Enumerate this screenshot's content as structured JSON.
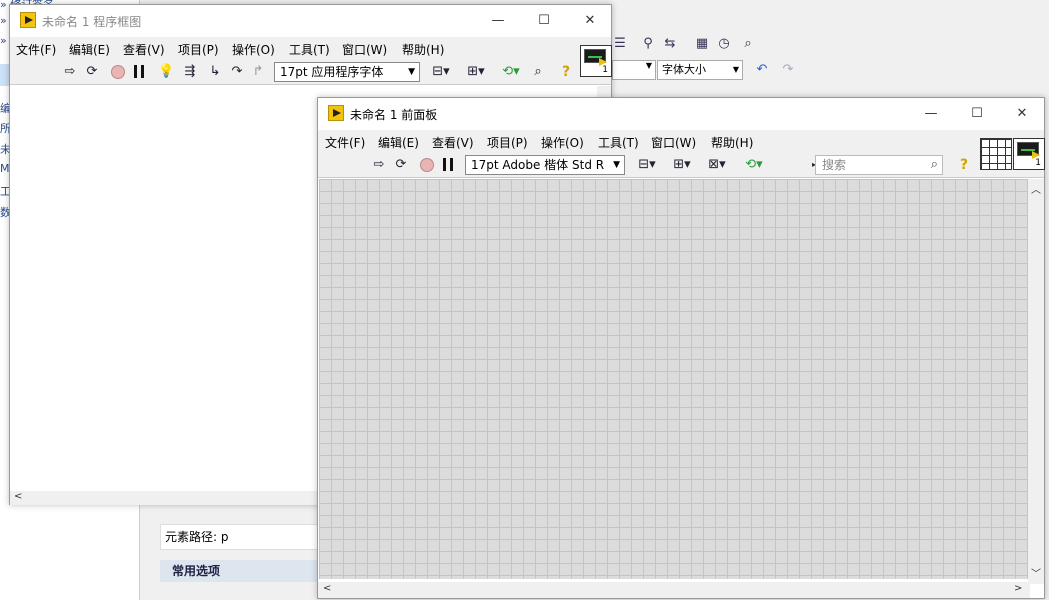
{
  "background": {
    "left_lines": [
      "» 修订签名",
      "»",
      "»",
      "编",
      "所",
      "未",
      "M",
      "工",
      "数"
    ],
    "font_size_placeholder": "字体大小",
    "element_path_label": "元素路径: p",
    "common_options_label": "常用选项"
  },
  "block_diagram": {
    "title": "未命名 1 程序框图",
    "menu": [
      "文件(F)",
      "编辑(E)",
      "查看(V)",
      "项目(P)",
      "操作(O)",
      "工具(T)",
      "窗口(W)",
      "帮助(H)"
    ],
    "font": "17pt 应用程序字体",
    "icon_number": "1"
  },
  "front_panel": {
    "title": "未命名 1 前面板",
    "menu": [
      "文件(F)",
      "编辑(E)",
      "查看(V)",
      "项目(P)",
      "操作(O)",
      "工具(T)",
      "窗口(W)",
      "帮助(H)"
    ],
    "font": "17pt Adobe 楷体 Std R",
    "search_placeholder": "搜索",
    "icon_number": "1"
  },
  "window_controls": {
    "minimize": "—",
    "maximize": "☐",
    "close": "✕"
  },
  "colors": {
    "labview_yellow": "#f2c40c",
    "grid": "#dcdcdc",
    "grid_line": "#c4c4c4"
  }
}
